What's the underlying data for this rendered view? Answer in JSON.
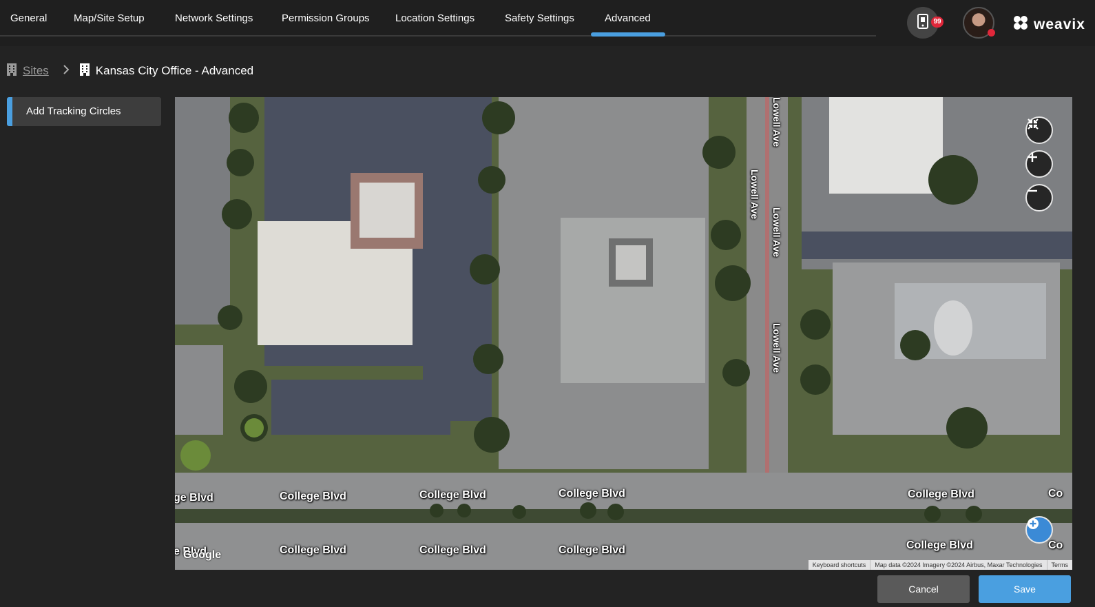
{
  "nav": {
    "tabs": [
      {
        "label": "General"
      },
      {
        "label": "Map/Site Setup"
      },
      {
        "label": "Network Settings"
      },
      {
        "label": "Permission Groups"
      },
      {
        "label": "Location Settings"
      },
      {
        "label": "Safety Settings"
      },
      {
        "label": "Advanced",
        "active": true
      }
    ],
    "notification_count": "99",
    "brand": "weavix",
    "accent_color": "#4a9fe0",
    "alert_color": "#e0273a"
  },
  "breadcrumb": {
    "root": "Sites",
    "current": "Kansas City Office - Advanced"
  },
  "sidebar": {
    "items": [
      {
        "label": "Add Tracking Circles",
        "active": true
      }
    ]
  },
  "map": {
    "roads": {
      "college": "College Blvd",
      "college_partial_left": "ge Blvd",
      "college_partial_left2": "e Blvd",
      "college_partial_right": "Co",
      "lowell": "Lowell Ave"
    },
    "google_logo": "Google",
    "attribution": {
      "shortcuts": "Keyboard shortcuts",
      "data": "Map data ©2024 Imagery ©2024 Airbus, Maxar Technologies",
      "terms": "Terms"
    },
    "controls": [
      "collapse-icon",
      "zoom-in-icon",
      "zoom-out-icon",
      "add-circle-icon"
    ]
  },
  "footer": {
    "cancel_label": "Cancel",
    "save_label": "Save"
  }
}
